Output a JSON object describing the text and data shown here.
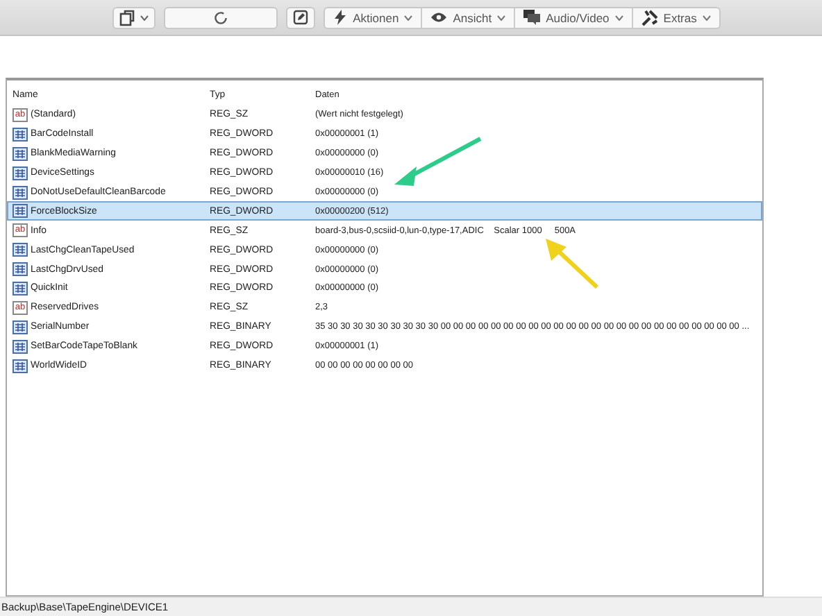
{
  "toolbar": {
    "menus": [
      {
        "label": "Aktionen",
        "kind": "bolt"
      },
      {
        "label": "Ansicht",
        "kind": "eye"
      },
      {
        "label": "Audio/Video",
        "kind": "media"
      },
      {
        "label": "Extras",
        "kind": "tools"
      }
    ]
  },
  "table": {
    "columns": [
      "Name",
      "Typ",
      "Daten"
    ],
    "rows": [
      {
        "kind": "string",
        "icon_label": "ab",
        "name": "(Standard)",
        "type": "REG_SZ",
        "data": "(Wert nicht festgelegt)",
        "selected": false
      },
      {
        "kind": "binary",
        "name": "BarCodeInstall",
        "type": "REG_DWORD",
        "data": "0x00000001 (1)",
        "selected": false
      },
      {
        "kind": "binary",
        "name": "BlankMediaWarning",
        "type": "REG_DWORD",
        "data": "0x00000000 (0)",
        "selected": false
      },
      {
        "kind": "binary",
        "name": "DeviceSettings",
        "type": "REG_DWORD",
        "data": "0x00000010 (16)",
        "selected": false
      },
      {
        "kind": "binary",
        "name": "DoNotUseDefaultCleanBarcode",
        "type": "REG_DWORD",
        "data": "0x00000000 (0)",
        "selected": false
      },
      {
        "kind": "binary",
        "name": "ForceBlockSize",
        "type": "REG_DWORD",
        "data": "0x00000200 (512)",
        "selected": true
      },
      {
        "kind": "string",
        "icon_label": "ab",
        "name": "Info",
        "type": "REG_SZ",
        "data": "board-3,bus-0,scsiid-0,lun-0,type-17,ADIC    Scalar 1000     500A",
        "selected": false
      },
      {
        "kind": "binary",
        "name": "LastChgCleanTapeUsed",
        "type": "REG_DWORD",
        "data": "0x00000000 (0)",
        "selected": false
      },
      {
        "kind": "binary",
        "name": "LastChgDrvUsed",
        "type": "REG_DWORD",
        "data": "0x00000000 (0)",
        "selected": false
      },
      {
        "kind": "binary",
        "name": "QuickInit",
        "type": "REG_DWORD",
        "data": "0x00000000 (0)",
        "selected": false
      },
      {
        "kind": "string",
        "icon_label": "ab",
        "name": "ReservedDrives",
        "type": "REG_SZ",
        "data": "2,3",
        "selected": false
      },
      {
        "kind": "binary",
        "name": "SerialNumber",
        "type": "REG_BINARY",
        "data": "35 30 30 30 30 30 30 30 30 30 00 00 00 00 00 00 00 00 00 00 00 00 00 00 00 00 00 00 00 00 00 00 00 00 ...",
        "selected": false
      },
      {
        "kind": "binary",
        "name": "SetBarCodeTapeToBlank",
        "type": "REG_DWORD",
        "data": "0x00000001 (1)",
        "selected": false
      },
      {
        "kind": "binary",
        "name": "WorldWideID",
        "type": "REG_BINARY",
        "data": "00 00 00 00 00 00 00 00",
        "selected": false
      }
    ]
  },
  "status_bar": "Backup\\Base\\TapeEngine\\DEVICE1"
}
